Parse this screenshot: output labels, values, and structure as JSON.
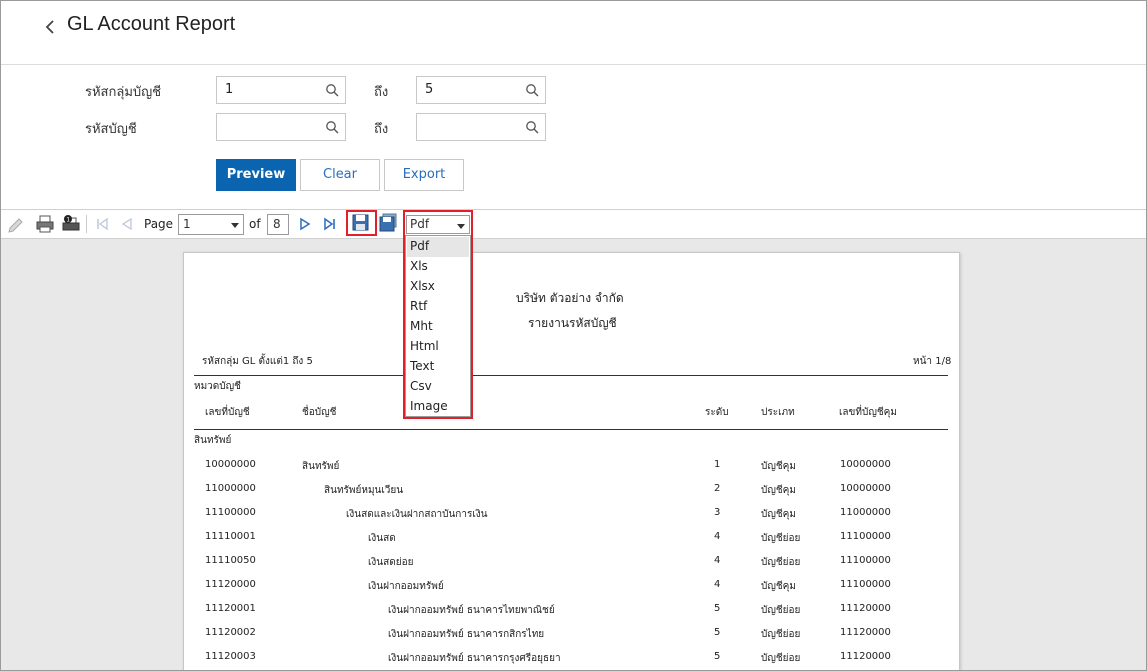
{
  "header": {
    "title": "GL Account Report"
  },
  "filters": {
    "group_label": "รหัสกลุ่มบัญชี",
    "account_label": "รหัสบัญชี",
    "to_label": "ถึง",
    "group_from": "1",
    "group_to": "5",
    "account_from": "",
    "account_to": ""
  },
  "buttons": {
    "preview": "Preview",
    "clear": "Clear",
    "export": "Export"
  },
  "toolbar": {
    "page_label": "Page",
    "current_page": "1",
    "of_label": "of",
    "total_pages": "8",
    "format_selected": "Pdf"
  },
  "format_options": [
    "Pdf",
    "Xls",
    "Xlsx",
    "Rtf",
    "Mht",
    "Html",
    "Text",
    "Csv",
    "Image"
  ],
  "report": {
    "company": "บริษัท ตัวอย่าง จำกัด",
    "title": "รายงานรหัสบัญชี",
    "criteria": "รหัสกลุ่ม GL ตั้งแต่1 ถึง 5",
    "page_info": "หน้า 1/8",
    "category_header": "หมวดบัญชี",
    "columns": [
      "เลขที่บัญชี",
      "ชื่อบัญชี",
      "ระดับ",
      "ประเภท",
      "เลขที่บัญชีคุม"
    ],
    "group_name": "สินทรัพย์",
    "rows": [
      [
        "10000000",
        "สินทรัพย์",
        "1",
        "บัญชีคุม",
        "10000000"
      ],
      [
        "11000000",
        "สินทรัพย์หมุนเวียน",
        "2",
        "บัญชีคุม",
        "10000000"
      ],
      [
        "11100000",
        "เงินสดและเงินฝากสถาบันการเงิน",
        "3",
        "บัญชีคุม",
        "11000000"
      ],
      [
        "11110001",
        "เงินสด",
        "4",
        "บัญชีย่อย",
        "11100000"
      ],
      [
        "11110050",
        "เงินสดย่อย",
        "4",
        "บัญชีย่อย",
        "11100000"
      ],
      [
        "11120000",
        "เงินฝากออมทรัพย์",
        "4",
        "บัญชีคุม",
        "11100000"
      ],
      [
        "11120001",
        "เงินฝากออมทรัพย์ ธนาคารไทยพาณิชย์",
        "5",
        "บัญชีย่อย",
        "11120000"
      ],
      [
        "11120002",
        "เงินฝากออมทรัพย์ ธนาคารกสิกรไทย",
        "5",
        "บัญชีย่อย",
        "11120000"
      ],
      [
        "11120003",
        "เงินฝากออมทรัพย์ ธนาคารกรุงศรีอยุธยา",
        "5",
        "บัญชีย่อย",
        "11120000"
      ]
    ]
  },
  "colors": {
    "primary": "#0a64b0",
    "highlight": "#e0202a"
  }
}
